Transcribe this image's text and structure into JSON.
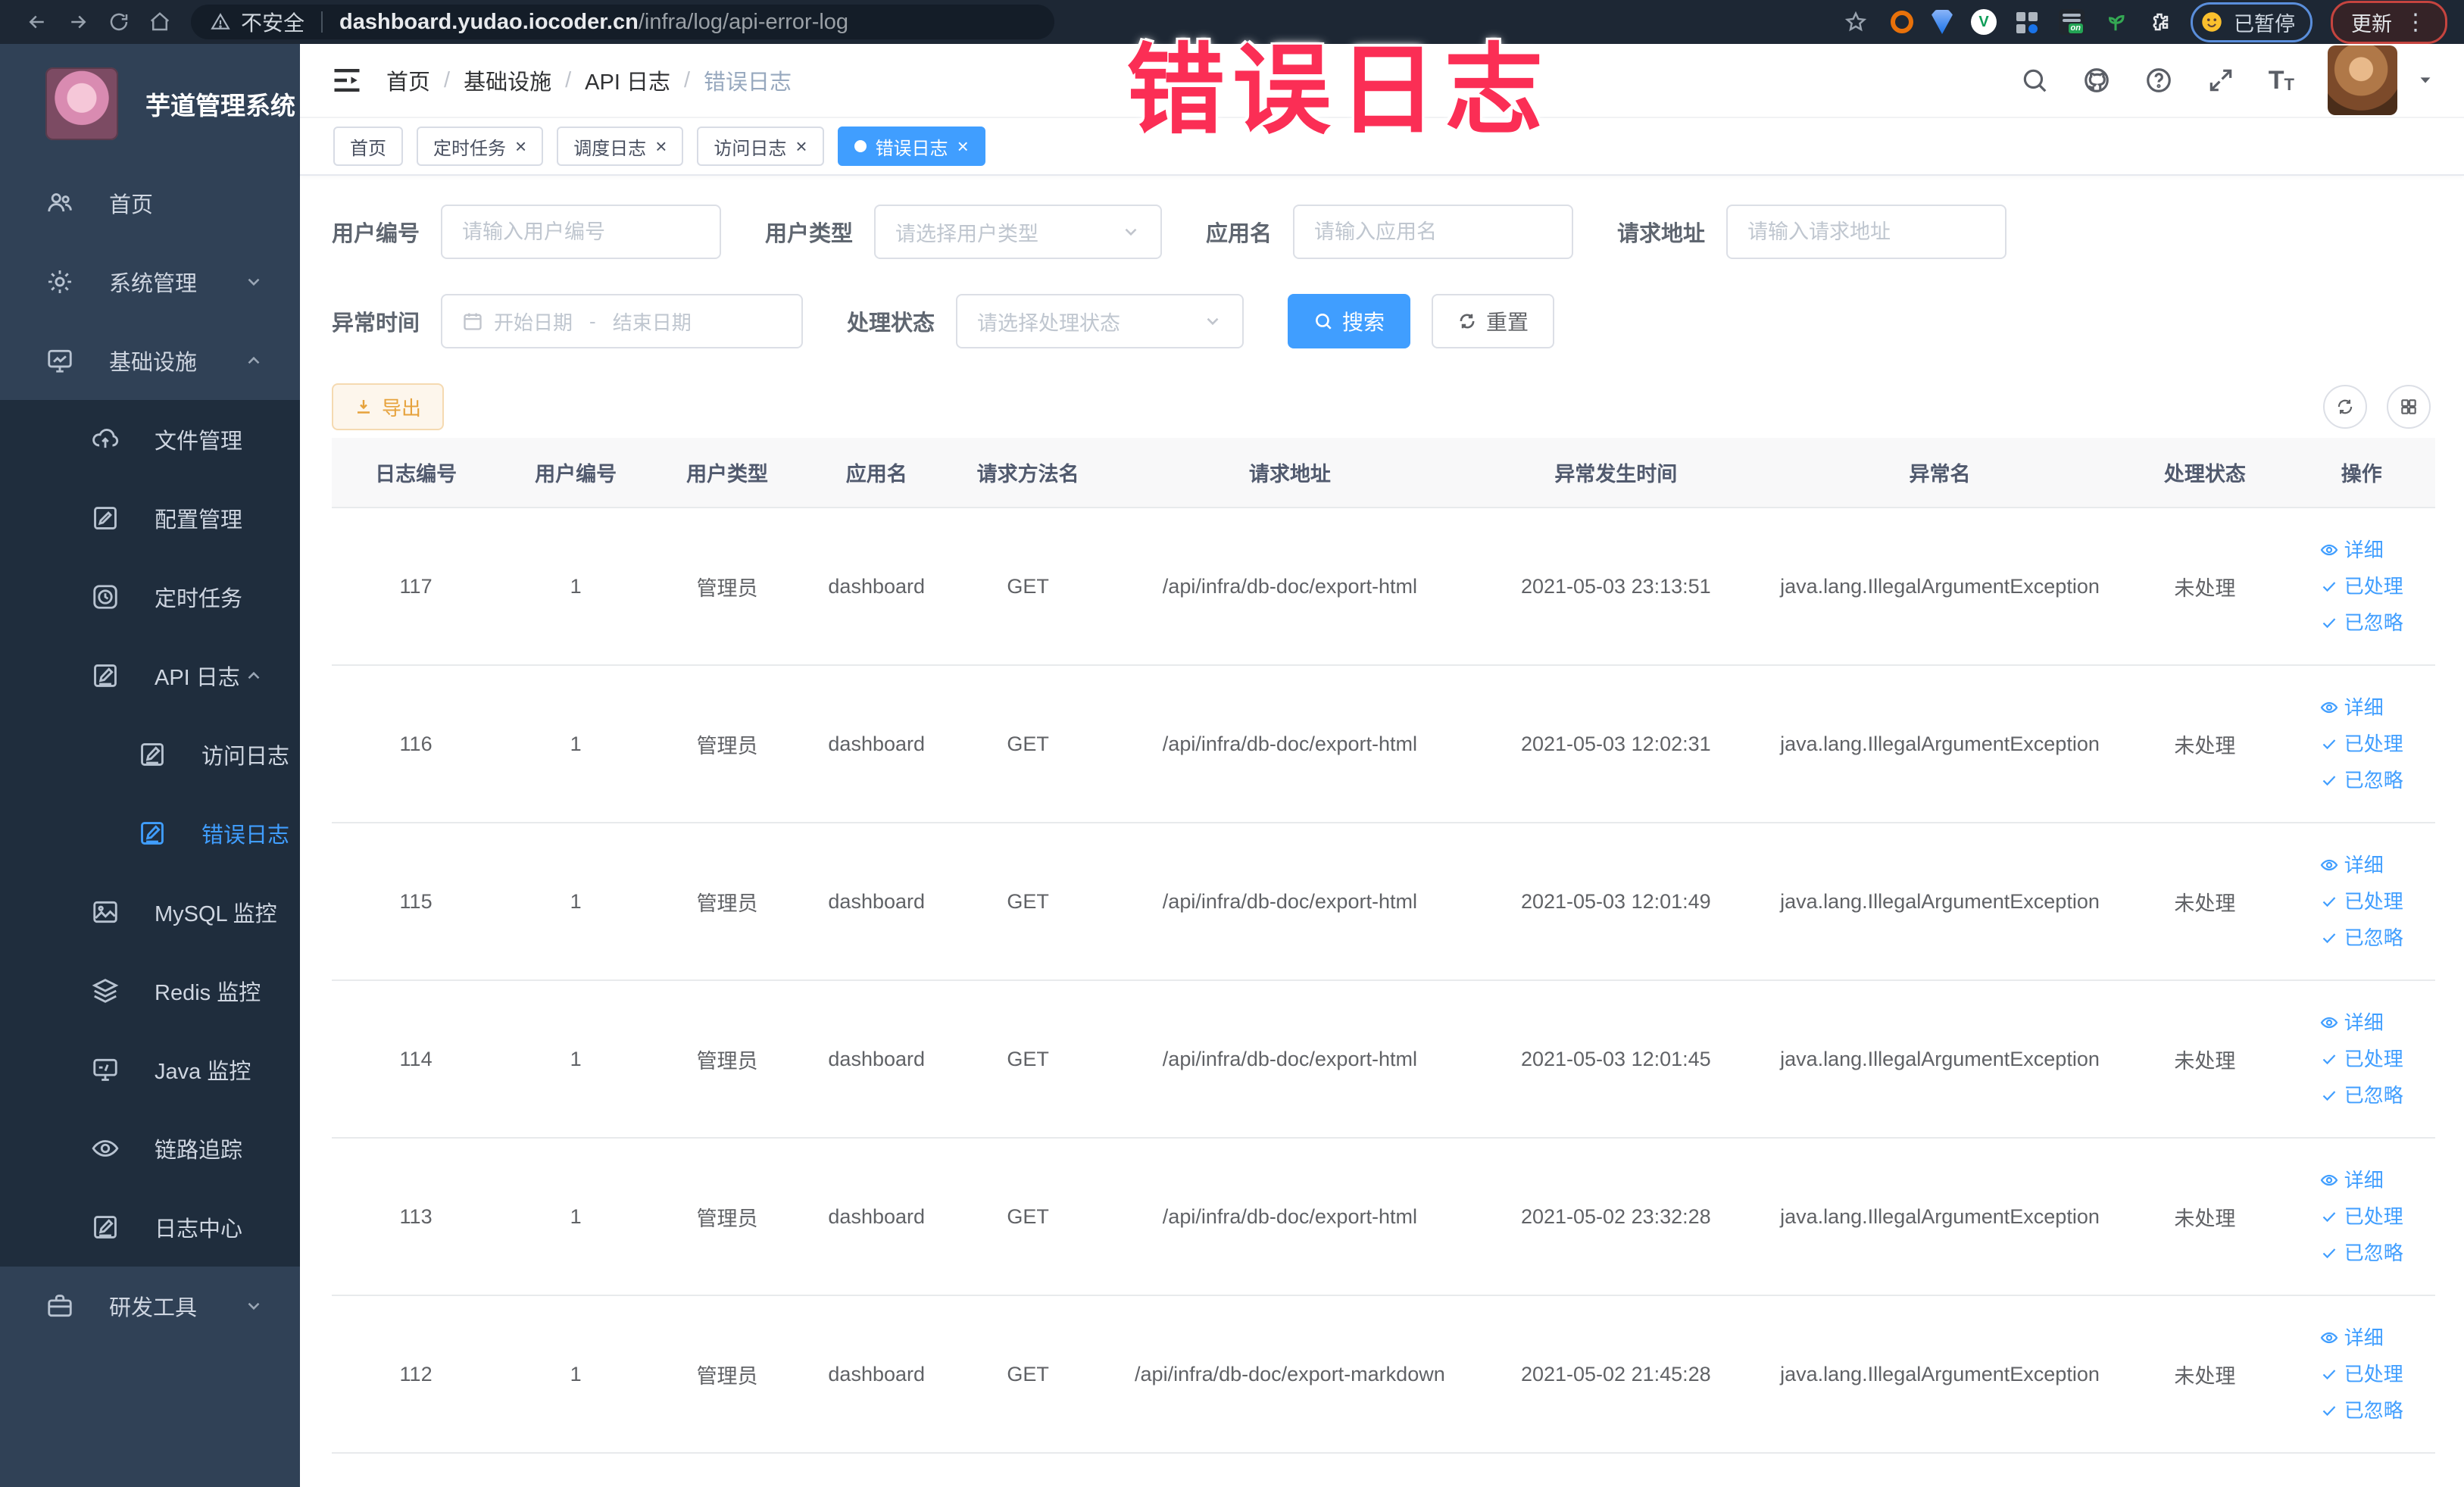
{
  "browser": {
    "security_label": "不安全",
    "url_domain": "dashboard.yudao.iocoder.cn",
    "url_path": "/infra/log/api-error-log",
    "paused_label": "已暂停",
    "update_label": "更新"
  },
  "overlay": {
    "text": "错误日志"
  },
  "sidebar": {
    "title": "芋道管理系统",
    "menu": [
      {
        "key": "home",
        "label": "首页",
        "icon": "people",
        "level": 1
      },
      {
        "key": "system",
        "label": "系统管理",
        "icon": "gear",
        "level": 1,
        "chevron": "down"
      },
      {
        "key": "infra",
        "label": "基础设施",
        "icon": "monitor",
        "level": 1,
        "chevron": "up"
      },
      {
        "key": "file",
        "label": "文件管理",
        "icon": "cloud",
        "level": 2
      },
      {
        "key": "config",
        "label": "配置管理",
        "icon": "edit",
        "level": 2
      },
      {
        "key": "job",
        "label": "定时任务",
        "icon": "timer",
        "level": 2
      },
      {
        "key": "api-log",
        "label": "API 日志",
        "icon": "log",
        "level": 2,
        "chevron": "up"
      },
      {
        "key": "access-log",
        "label": "访问日志",
        "icon": "log",
        "level": 3
      },
      {
        "key": "error-log",
        "label": "错误日志",
        "icon": "log",
        "level": 3,
        "active": true
      },
      {
        "key": "mysql",
        "label": "MySQL 监控",
        "icon": "chart",
        "level": 2
      },
      {
        "key": "redis",
        "label": "Redis 监控",
        "icon": "layers",
        "level": 2
      },
      {
        "key": "java",
        "label": "Java 监控",
        "icon": "screen",
        "level": 2
      },
      {
        "key": "tracer",
        "label": "链路追踪",
        "icon": "eye",
        "level": 2
      },
      {
        "key": "log-center",
        "label": "日志中心",
        "icon": "log",
        "level": 2
      },
      {
        "key": "dev-tools",
        "label": "研发工具",
        "icon": "briefcase",
        "level": 1,
        "chevron": "down"
      }
    ]
  },
  "breadcrumb": {
    "items": [
      "首页",
      "基础设施",
      "API 日志",
      "错误日志"
    ]
  },
  "tags": [
    {
      "label": "首页",
      "closable": false,
      "active": false
    },
    {
      "label": "定时任务",
      "closable": true,
      "active": false
    },
    {
      "label": "调度日志",
      "closable": true,
      "active": false
    },
    {
      "label": "访问日志",
      "closable": true,
      "active": false
    },
    {
      "label": "错误日志",
      "closable": true,
      "active": true
    }
  ],
  "filters": {
    "user_id": {
      "label": "用户编号",
      "placeholder": "请输入用户编号"
    },
    "user_type": {
      "label": "用户类型",
      "placeholder": "请选择用户类型"
    },
    "app_name": {
      "label": "应用名",
      "placeholder": "请输入应用名"
    },
    "request_url": {
      "label": "请求地址",
      "placeholder": "请输入请求地址"
    },
    "exception_time": {
      "label": "异常时间",
      "start_placeholder": "开始日期",
      "separator": "-",
      "end_placeholder": "结束日期"
    },
    "process_status": {
      "label": "处理状态",
      "placeholder": "请选择处理状态"
    },
    "search_label": "搜索",
    "reset_label": "重置"
  },
  "toolbar": {
    "export_label": "导出"
  },
  "table": {
    "columns": [
      "日志编号",
      "用户编号",
      "用户类型",
      "应用名",
      "请求方法名",
      "请求地址",
      "异常发生时间",
      "异常名",
      "处理状态",
      "操作"
    ],
    "actions": [
      "详细",
      "已处理",
      "已忽略"
    ],
    "rows": [
      {
        "id": "117",
        "user_id": "1",
        "user_type": "管理员",
        "app_name": "dashboard",
        "method": "GET",
        "url": "/api/infra/db-doc/export-html",
        "time": "2021-05-03 23:13:51",
        "exception": "java.lang.IllegalArgumentException",
        "status": "未处理"
      },
      {
        "id": "116",
        "user_id": "1",
        "user_type": "管理员",
        "app_name": "dashboard",
        "method": "GET",
        "url": "/api/infra/db-doc/export-html",
        "time": "2021-05-03 12:02:31",
        "exception": "java.lang.IllegalArgumentException",
        "status": "未处理"
      },
      {
        "id": "115",
        "user_id": "1",
        "user_type": "管理员",
        "app_name": "dashboard",
        "method": "GET",
        "url": "/api/infra/db-doc/export-html",
        "time": "2021-05-03 12:01:49",
        "exception": "java.lang.IllegalArgumentException",
        "status": "未处理"
      },
      {
        "id": "114",
        "user_id": "1",
        "user_type": "管理员",
        "app_name": "dashboard",
        "method": "GET",
        "url": "/api/infra/db-doc/export-html",
        "time": "2021-05-03 12:01:45",
        "exception": "java.lang.IllegalArgumentException",
        "status": "未处理"
      },
      {
        "id": "113",
        "user_id": "1",
        "user_type": "管理员",
        "app_name": "dashboard",
        "method": "GET",
        "url": "/api/infra/db-doc/export-html",
        "time": "2021-05-02 23:32:28",
        "exception": "java.lang.IllegalArgumentException",
        "status": "未处理"
      },
      {
        "id": "112",
        "user_id": "1",
        "user_type": "管理员",
        "app_name": "dashboard",
        "method": "GET",
        "url": "/api/infra/db-doc/export-markdown",
        "time": "2021-05-02 21:45:28",
        "exception": "java.lang.IllegalArgumentException",
        "status": "未处理"
      }
    ]
  },
  "colors": {
    "accent_blue": "#409eff",
    "sidebar_bg": "#304156",
    "sidebar_submenu_bg": "#1f2d3d",
    "warning_orange": "#e6a23c",
    "annotation_red": "#fb2e55",
    "chrome_bar": "#1d2734",
    "table_header_bg": "#f8f8f9"
  }
}
